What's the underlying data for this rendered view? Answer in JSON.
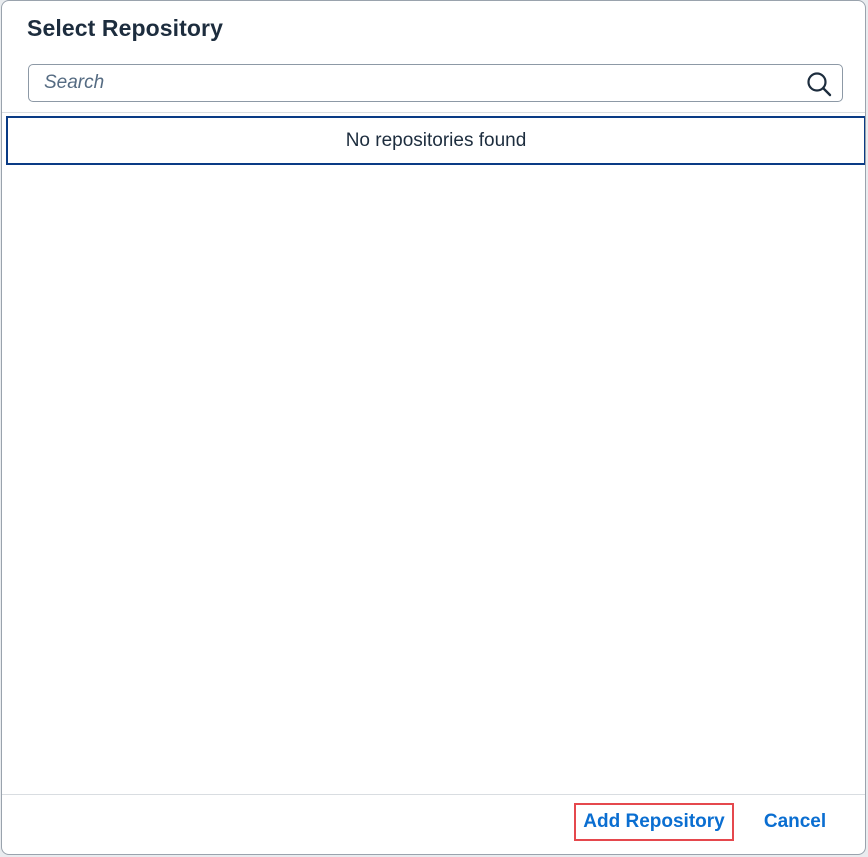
{
  "dialog": {
    "title": "Select Repository",
    "search": {
      "placeholder": "Search",
      "value": "",
      "icon": "search-icon"
    },
    "empty_message": "No repositories found",
    "footer": {
      "add_label": "Add Repository",
      "cancel_label": "Cancel"
    }
  },
  "colors": {
    "title": "#1d2d3e",
    "link_button": "#0a6ed1",
    "focus_border": "#0a3b85",
    "highlight_border": "#e5484d"
  }
}
